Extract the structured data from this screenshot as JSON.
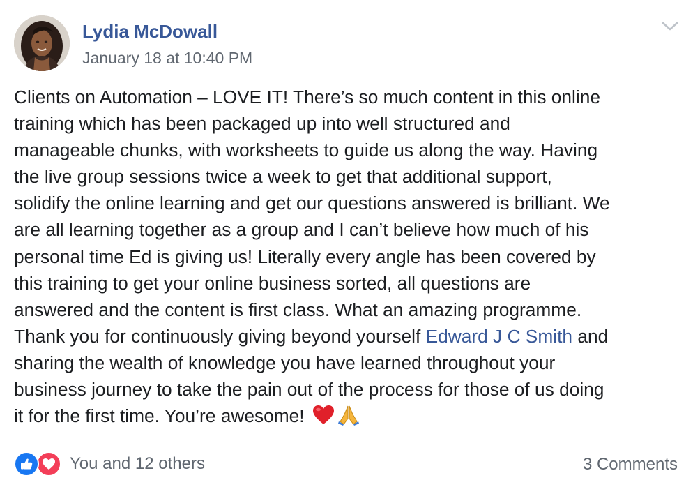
{
  "post": {
    "author_name": "Lydia McDowall",
    "timestamp": "January 18 at 10:40 PM",
    "body_lines": [
      {
        "text": "Clients on Automation – LOVE IT! There’s so much content in this online"
      },
      {
        "text": "training which has been packaged up into well structured and"
      },
      {
        "text": "manageable chunks, with worksheets to guide us along the way. Having"
      },
      {
        "text": "the live group sessions twice a week to get that additional support,"
      },
      {
        "text": "solidify the online learning and get our questions answered is brilliant. We"
      },
      {
        "text": "are all learning together as a group and I can’t believe how much of his"
      },
      {
        "text": "personal time Ed is giving us! Literally every angle has been covered by"
      },
      {
        "text": "this training to get your online business sorted, all questions are"
      },
      {
        "text": "answered and the content is first class. What an amazing programme."
      }
    ],
    "mention_line": {
      "before": "Thank you for continuously giving beyond yourself ",
      "mention": "Edward J C Smith",
      "after": " and"
    },
    "body_lines_after": [
      {
        "text": "sharing the wealth of knowledge you have learned throughout your"
      },
      {
        "text": "business journey to take the pain out of the process for those of us doing"
      }
    ],
    "last_line": "it for the first time. You’re awesome! ",
    "emojis": [
      "heart-emoji",
      "folded-hands-emoji"
    ]
  },
  "footer": {
    "reaction_icons": [
      "like-icon",
      "love-icon"
    ],
    "reactions_text": "You and 12 others",
    "comments_text": "3 Comments"
  },
  "colors": {
    "link": "#385898",
    "secondary_text": "#606770",
    "body_text": "#1c1e21",
    "like_blue": "#1877f2",
    "love_red": "#f33e58"
  }
}
